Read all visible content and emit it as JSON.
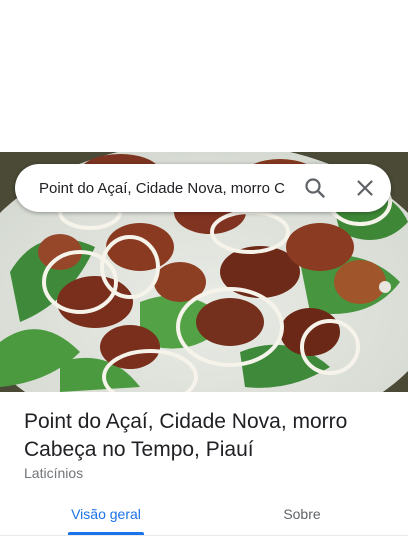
{
  "search": {
    "query": "Point do Açaí, Cidade Nova, morro C"
  },
  "place": {
    "title": "Point do Açaí, Cidade Nova, morro Cabeça no Tempo, Piauí",
    "category": "Laticínios"
  },
  "tabs": [
    {
      "label": "Visão geral",
      "selected": true
    },
    {
      "label": "Sobre",
      "selected": false
    }
  ],
  "icons": {
    "search": "search-icon",
    "close": "close-icon"
  },
  "colors": {
    "accent": "#1a73e8",
    "title_text": "#202124",
    "secondary_text": "#70757a"
  }
}
